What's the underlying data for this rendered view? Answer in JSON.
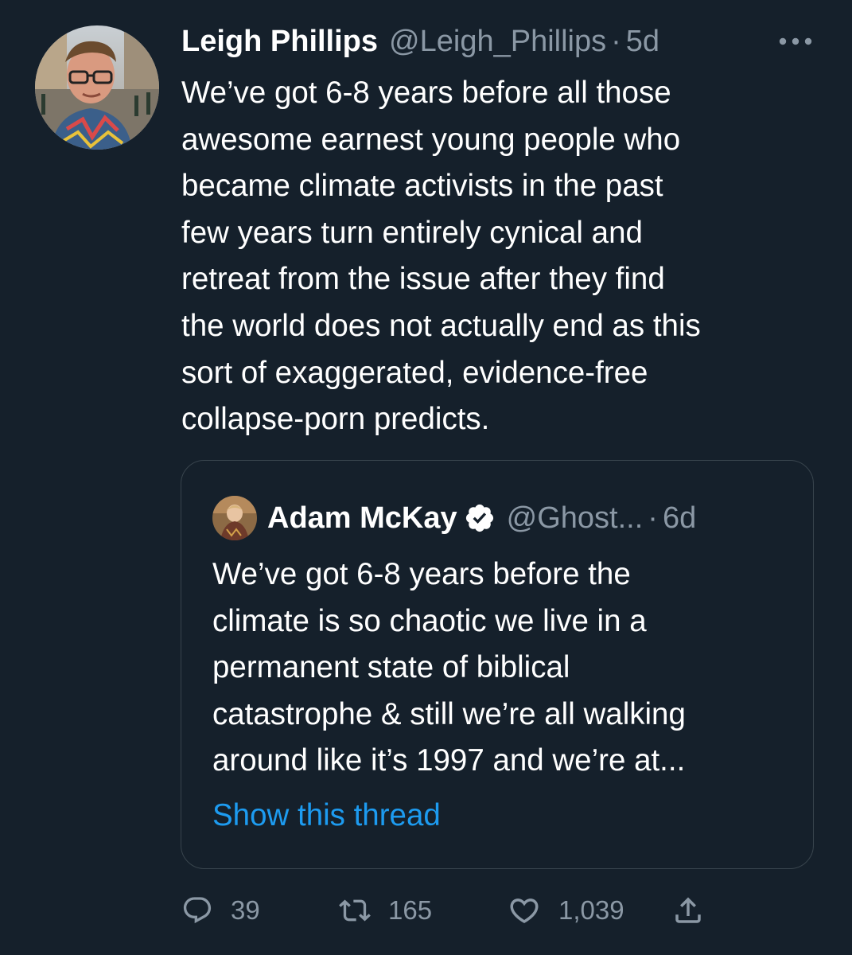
{
  "tweet": {
    "author_name": "Leigh Phillips",
    "author_handle": "@Leigh_Phillips",
    "separator": "·",
    "time": "5d",
    "text": "We’ve got 6-8 years before all those\nawesome earnest young people who\nbecame climate activists in the past\nfew years turn entirely cynical and\nretreat from the issue after they find\nthe world does not actually end as this\nsort of exaggerated, evidence-free\ncollapse-porn predicts."
  },
  "quoted_tweet": {
    "author_name": "Adam McKay",
    "author_handle": "@Ghost...",
    "separator": "·",
    "time": "6d",
    "text": "We’ve got 6-8 years before the\nclimate is so chaotic we live in a\npermanent state of biblical\ncatastrophe & still we’re all walking\naround like it’s 1997 and we’re at...",
    "show_thread_label": "Show this thread"
  },
  "actions": {
    "replies": "39",
    "retweets": "165",
    "likes": "1,039"
  },
  "icons": {
    "more": "more-horizontal-icon",
    "verified": "verified-badge-icon",
    "reply": "reply-icon",
    "retweet": "retweet-icon",
    "like": "like-icon",
    "share": "share-icon"
  },
  "colors": {
    "background": "#15202b",
    "text": "#ffffff",
    "secondary_text": "#8b98a5",
    "link": "#1d9bf0",
    "border": "#38444d"
  }
}
